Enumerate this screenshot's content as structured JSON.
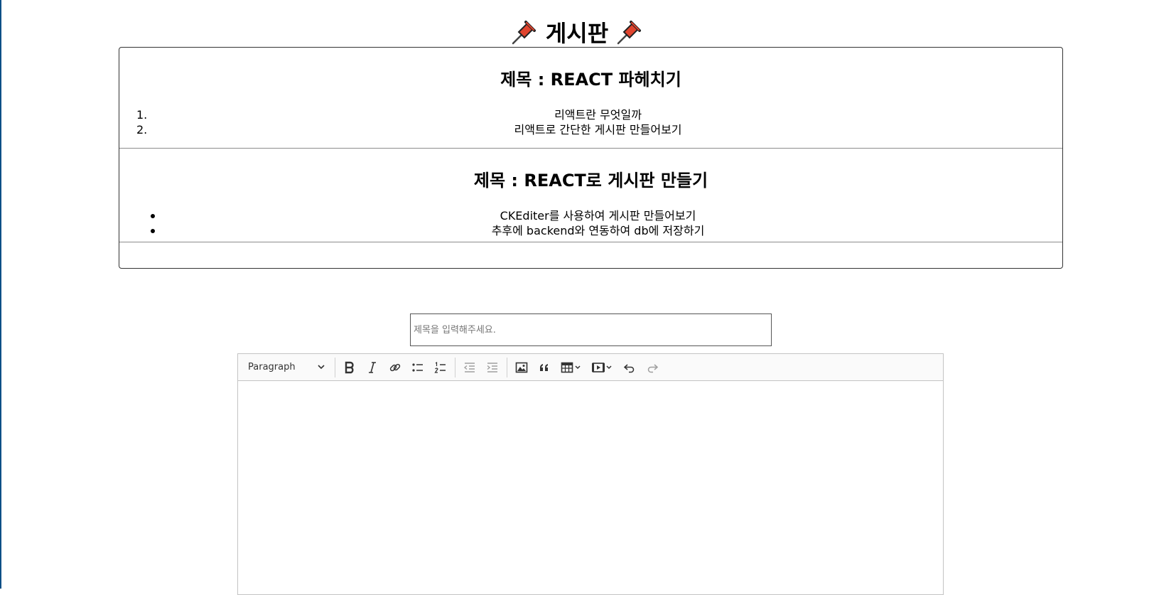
{
  "page": {
    "title": "게시판",
    "icon": "pushpin-icon"
  },
  "posts": [
    {
      "title": "제목 : REACT 파헤치기",
      "list_type": "ordered",
      "items": [
        {
          "marker": "1.",
          "text": "리액트란 무엇일까"
        },
        {
          "marker": "2.",
          "text": "리액트로 간단한 게시판 만들어보기"
        }
      ]
    },
    {
      "title": "제목 : REACT로 게시판 만들기",
      "list_type": "bulleted",
      "items": [
        {
          "text": "CKEditer를 사용하여 게시판 만들어보기"
        },
        {
          "text": "추후에 backend와 연동하여 db에 저장하기"
        }
      ]
    }
  ],
  "form": {
    "title_placeholder": "제목을 입력해주세요."
  },
  "editor": {
    "heading_select": "Paragraph",
    "tools": [
      "bold-icon",
      "italic-icon",
      "link-icon",
      "bulleted-list-icon",
      "numbered-list-icon",
      "outdent-icon",
      "indent-icon",
      "image-icon",
      "blockquote-icon",
      "table-icon",
      "media-icon",
      "undo-icon",
      "redo-icon"
    ],
    "colors": {
      "toolbar_bg": "#fafafa",
      "border": "#c4c4c4",
      "pin_red": "#e0442e",
      "left_edge": "#0d4f86"
    }
  }
}
